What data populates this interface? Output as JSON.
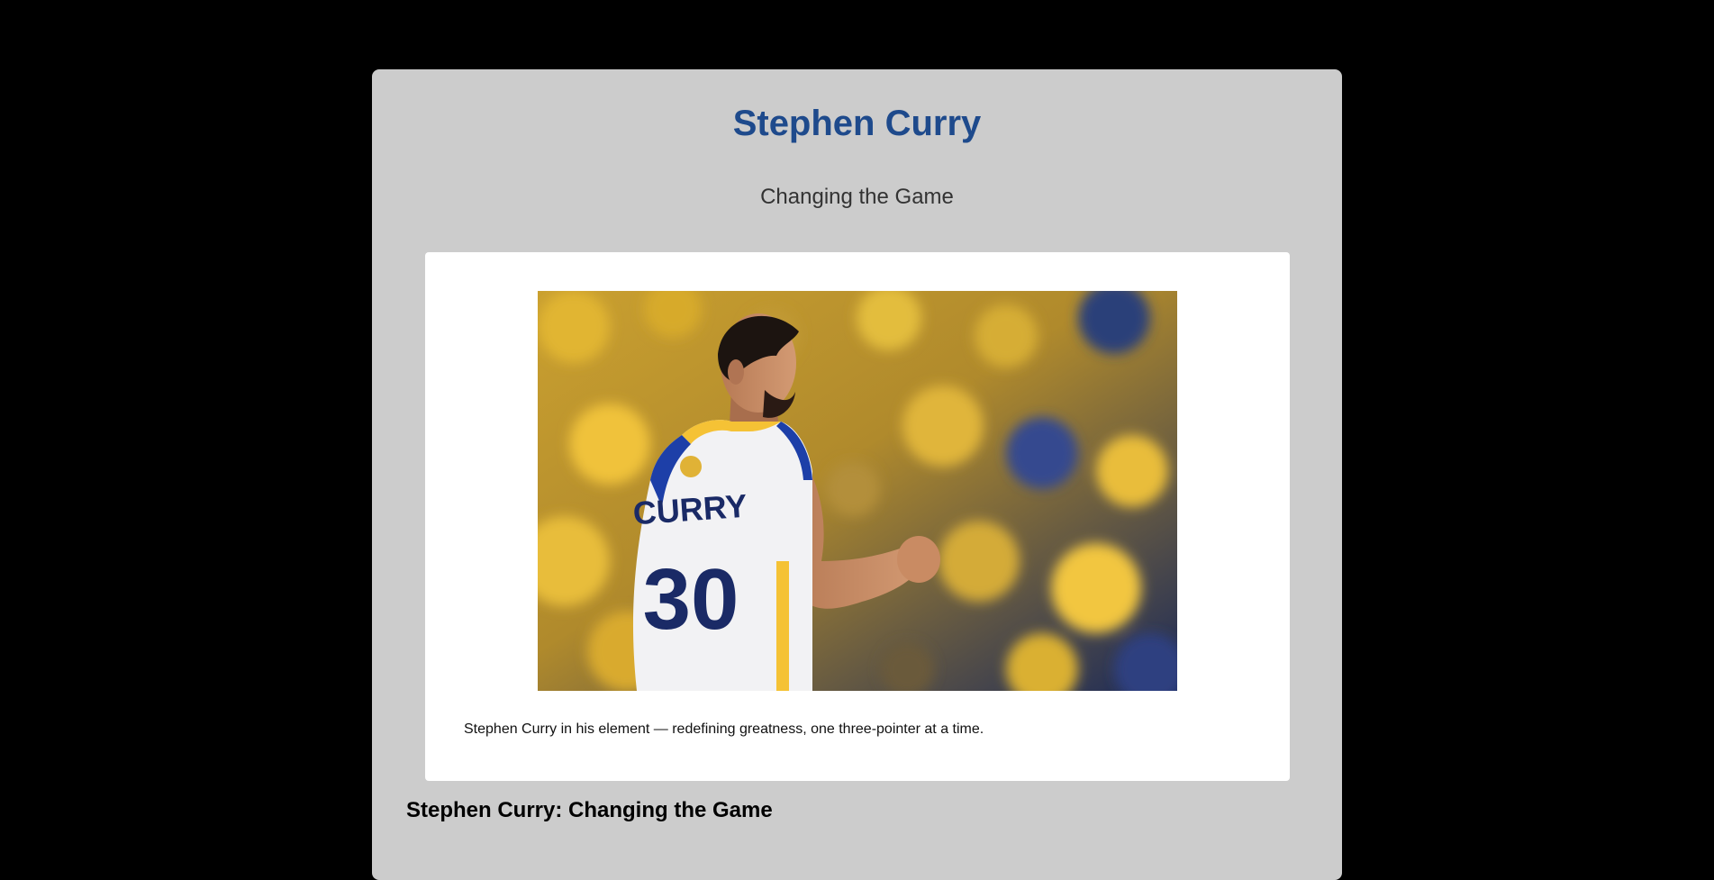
{
  "page": {
    "title": "Stephen Curry",
    "subtitle": "Changing the Game",
    "photo_alt": "Stephen Curry",
    "caption": "Stephen Curry in his element — redefining greatness, one three-pointer at a time.",
    "section_heading": "Stephen Curry: Changing the Game"
  },
  "jersey": {
    "name": "CURRY",
    "number": "30"
  },
  "colors": {
    "background": "#000000",
    "container": "#cccccc",
    "title": "#1e4a8c",
    "card": "#ffffff"
  }
}
